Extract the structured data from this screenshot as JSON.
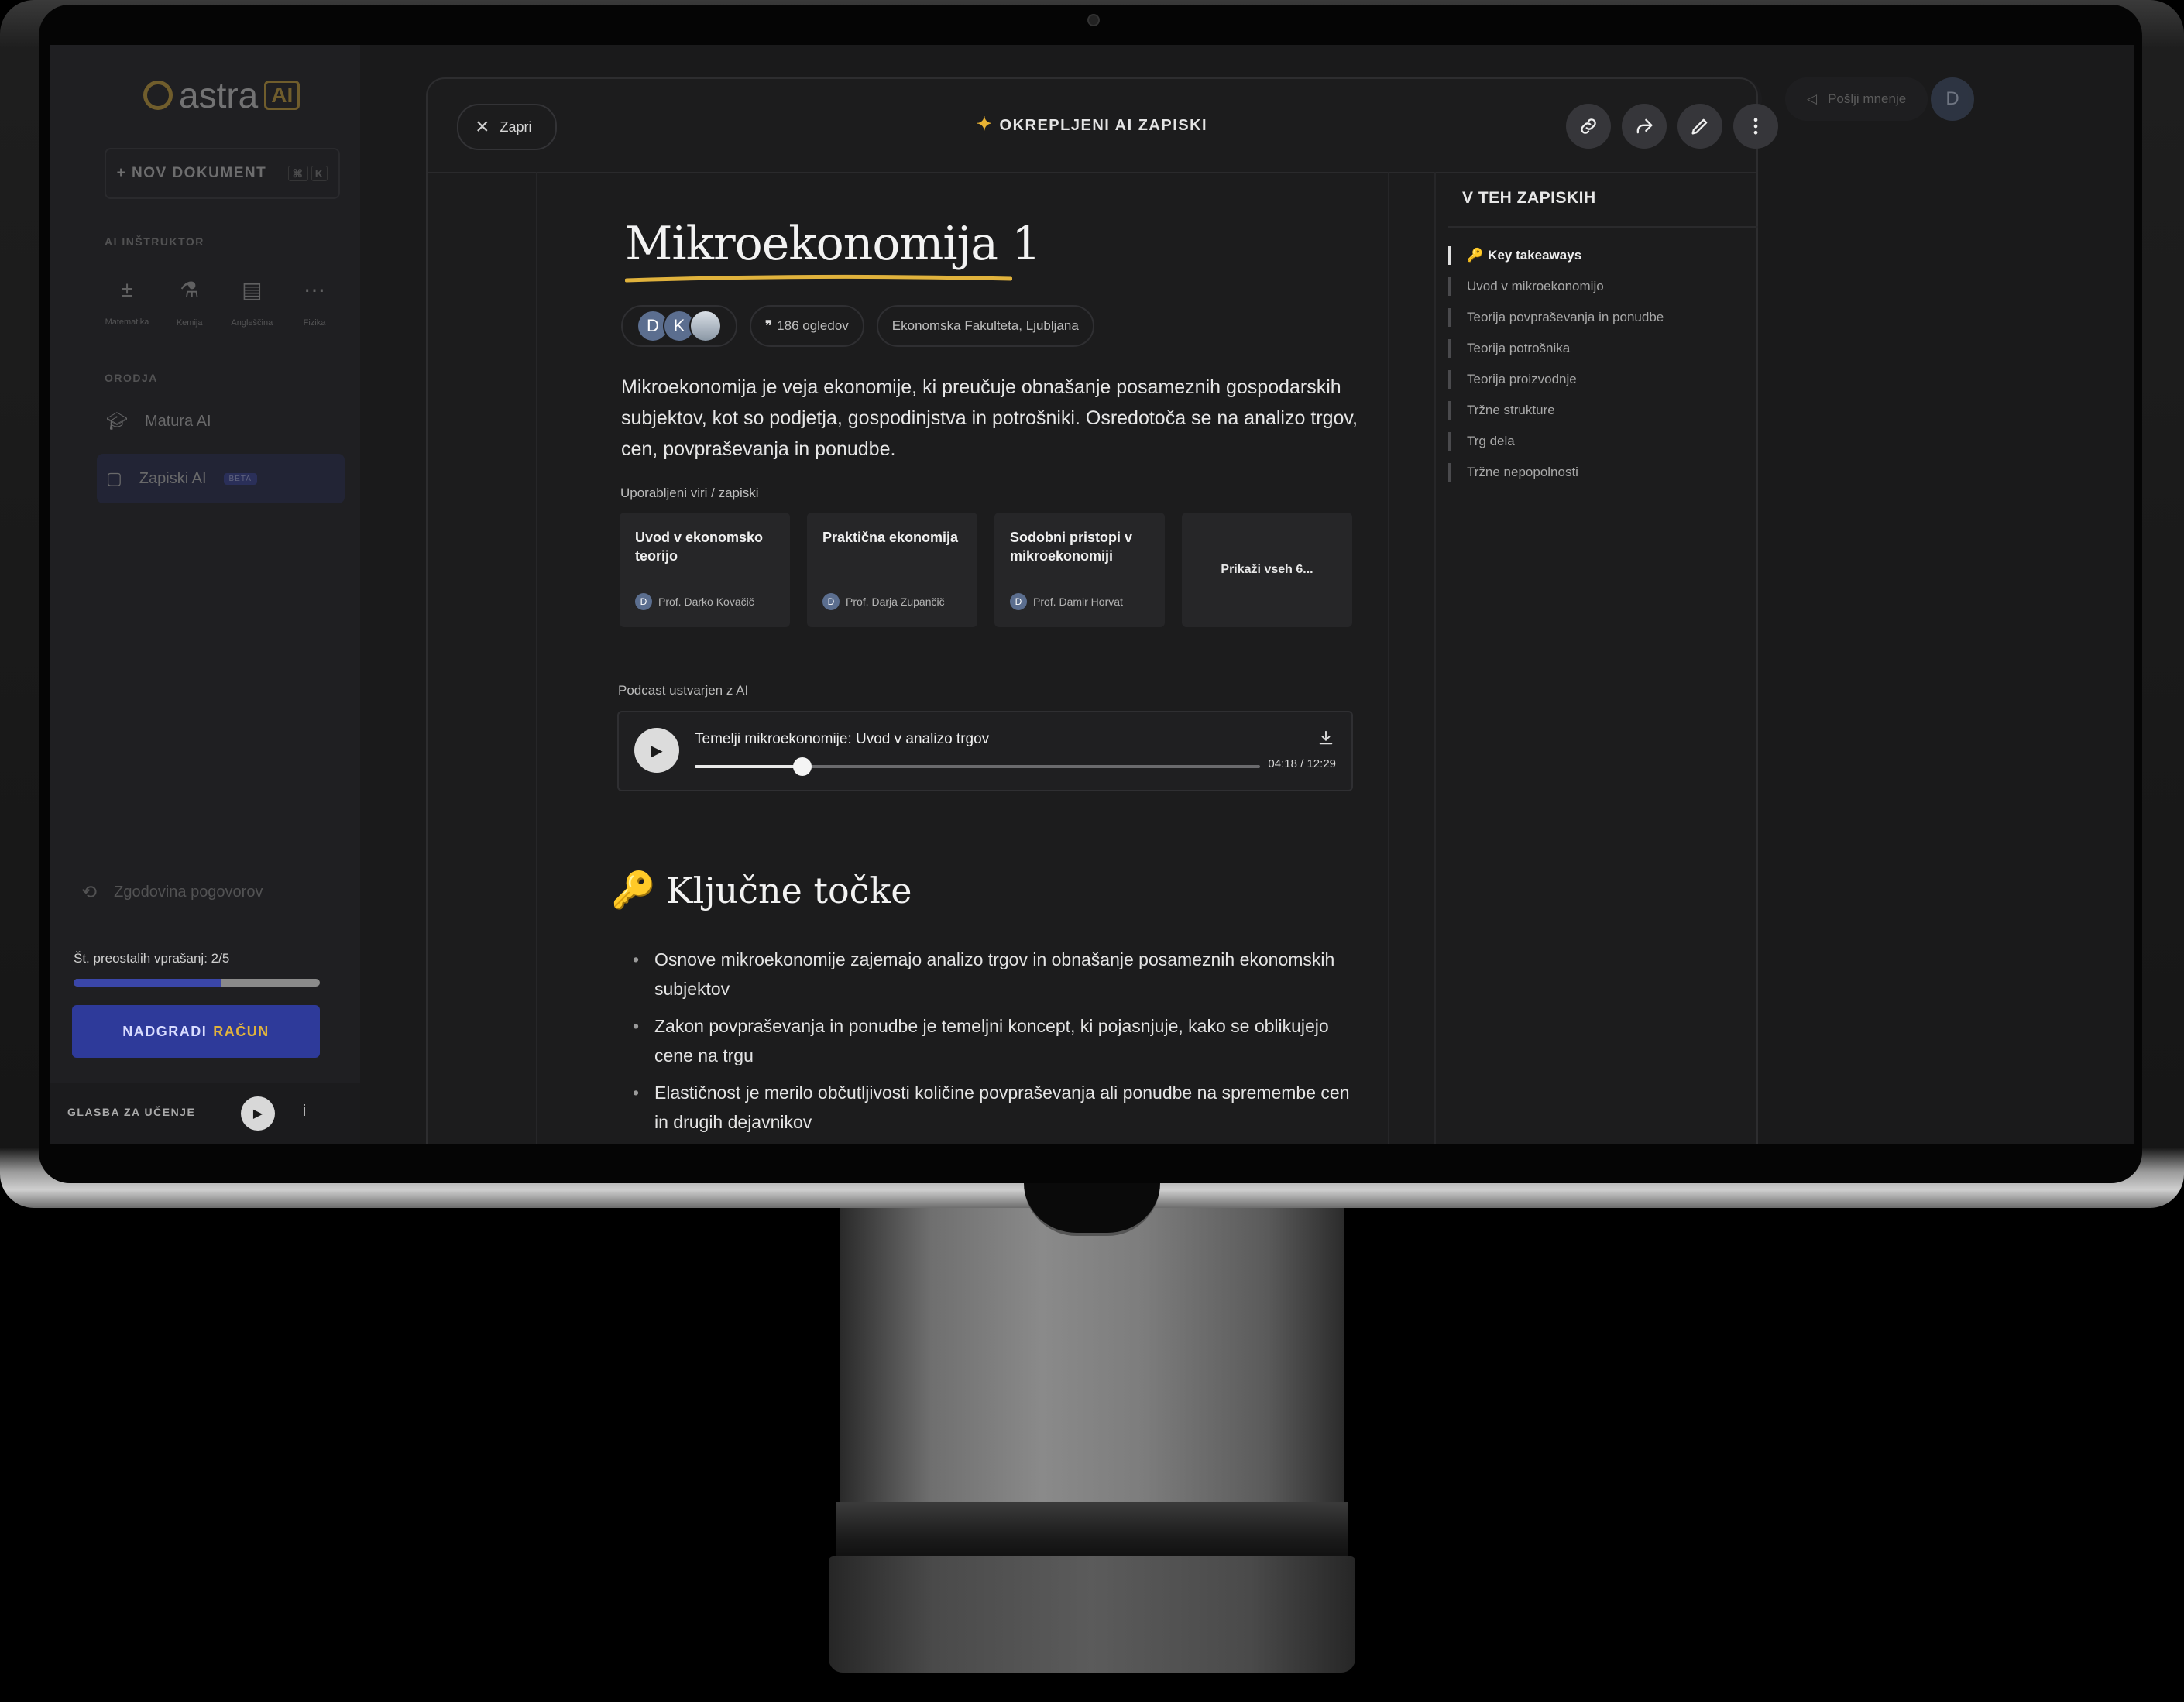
{
  "sidebar": {
    "logo_text": "astra",
    "logo_badge": "AI",
    "new_doc_label": "+ NOV DOKUMENT",
    "new_doc_shortcut": [
      "⌘",
      "K"
    ],
    "instructor_heading": "AI INŠTRUKTOR",
    "instructors": [
      {
        "icon": "math-icon",
        "label": "Matematika"
      },
      {
        "icon": "flask-icon",
        "label": "Kemija"
      },
      {
        "icon": "chat-icon",
        "label": "Angleščina"
      },
      {
        "icon": "more-icon",
        "label": "Fizika"
      }
    ],
    "tools_heading": "ORODJA",
    "tools": [
      {
        "icon": "graduation-cap-icon",
        "label": "Matura AI",
        "badge": ""
      },
      {
        "icon": "note-icon",
        "label": "Zapiski AI",
        "badge": "BETA"
      }
    ],
    "history_label": "Zgodovina pogovorov",
    "remaining_label": "Št. preostalih vprašanj: 2/5",
    "remaining_progress": 0.6,
    "upgrade_label": "NADGRADI",
    "upgrade_accent": "RAČUN",
    "music_label": "GLASBA ZA UČENJE"
  },
  "topbar": {
    "feedback_label": "Pošlji mnenje",
    "user_initial": "D"
  },
  "modal": {
    "close_label": "Zapri",
    "title": "OKREPLJENI AI ZAPISKI",
    "actions": [
      "link-icon",
      "share-icon",
      "pencil-icon",
      "more-vertical-icon"
    ]
  },
  "doc": {
    "title": "Mikroekonomija 1",
    "avatars": [
      "D",
      "K"
    ],
    "views": "186 ogledov",
    "institution": "Ekonomska Fakulteta, Ljubljana",
    "intro": "Mikroekonomija je veja ekonomije, ki preučuje obnašanje posameznih gospodarskih subjektov, kot so podjetja, gospodinjstva in potrošniki. Osredotoča se na analizo trgov, cen, povpraševanja in ponudbe.",
    "sources_label": "Uporabljeni viri / zapiski",
    "sources": [
      {
        "title": "Uvod v ekonomsko teorijo",
        "author_initial": "D",
        "author": "Prof. Darko Kovačič"
      },
      {
        "title": "Praktična ekonomija",
        "author_initial": "D",
        "author": "Prof. Darja Zupančič"
      },
      {
        "title": "Sodobni pristopi v mikroekonomiji",
        "author_initial": "D",
        "author": "Prof. Damir Horvat"
      }
    ],
    "sources_more": "Prikaži vseh 6...",
    "podcast_label": "Podcast ustvarjen z AI",
    "podcast": {
      "title": "Temelji mikroekonomije: Uvod v analizo trgov",
      "time": "04:18 / 12:29",
      "progress": 0.19
    },
    "key_heading": "Ključne točke",
    "key_emoji": "🔑",
    "key_points": [
      "Osnove mikroekonomije zajemajo analizo trgov in obnašanje posameznih ekonomskih subjektov",
      "Zakon povpraševanja in ponudbe je temeljni koncept, ki pojasnjuje, kako se oblikujejo cene na trgu",
      "Elastičnost je merilo občutljivosti količine povpraševanja ali ponudbe na spremembe cen in drugih dejavnikov"
    ]
  },
  "toc": {
    "title": "V TEH ZAPISKIH",
    "items": [
      "Key takeaways",
      "Uvod v mikroekonomijo",
      "Teorija povpraševanja in ponudbe",
      "Teorija potrošnika",
      "Teorija proizvodnje",
      "Tržne strukture",
      "Trg dela",
      "Tržne nepopolnosti"
    ]
  },
  "colors": {
    "accent_gold": "#e0b23c",
    "accent_blue": "#2e3a9a",
    "background": "#1c1c1d"
  }
}
